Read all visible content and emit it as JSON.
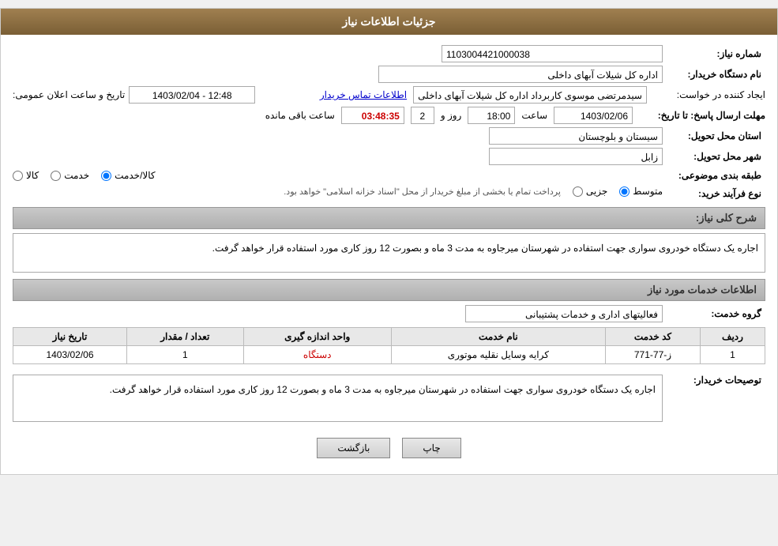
{
  "page": {
    "title": "جزئیات اطلاعات نیاز"
  },
  "header": {
    "shomara_niaz_label": "شماره نیاز:",
    "shomara_niaz_value": "1103004421000038",
    "nam_dastgah_label": "نام دستگاه خریدار:",
    "nam_dastgah_value": "اداره کل شیلات آبهای داخلی",
    "ijad_konande_label": "ایجاد کننده در خواست:",
    "ijad_konande_value": "سیدمرتضی موسوی کاربرداد اداره کل شیلات آبهای داخلی",
    "etelaat_link": "اطلاعات تماس خریدار",
    "tarikh_label": "تاریخ و ساعت اعلان عمومی:",
    "tarikh_value": "1403/02/04 - 12:48",
    "mohlat_label": "مهلت ارسال پاسخ: تا تاریخ:",
    "mohlat_date": "1403/02/06",
    "mohlat_saat_label": "ساعت",
    "mohlat_saat_value": "18:00",
    "mohlat_rooz_label": "روز و",
    "mohlat_rooz_value": "2",
    "mohlat_baqi_label": "ساعت باقی مانده",
    "mohlat_countdown": "03:48:35",
    "ostan_label": "استان محل تحویل:",
    "ostan_value": "سیستان و بلوچستان",
    "shahr_label": "شهر محل تحویل:",
    "shahr_value": "زابل",
    "tabaqe_label": "طبقه بندی موضوعی:",
    "tabaqe_options": [
      "کالا",
      "خدمت",
      "کالا/خدمت"
    ],
    "tabaqe_selected": "کالا/خدمت",
    "nooe_label": "نوع فرآیند خرید:",
    "nooe_options": [
      "جزیی",
      "متوسط"
    ],
    "nooe_selected": "متوسط",
    "nooe_note": "پرداخت تمام یا بخشی از مبلغ خریدار از محل \"اسناد خزانه اسلامی\" خواهد بود."
  },
  "sharh_section": {
    "title": "شرح کلی نیاز:",
    "text": "اجاره یک دستگاه خودروی سواری جهت استفاده در شهرستان میرجاوه به مدت 3 ماه و بصورت 12 روز کاری مورد استفاده قرار خواهد گرفت."
  },
  "khadamat_section": {
    "title": "اطلاعات خدمات مورد نیاز",
    "group_label": "گروه خدمت:",
    "group_value": "فعالیتهای اداری و خدمات پشتیبانی",
    "table": {
      "headers": [
        "ردیف",
        "کد خدمت",
        "نام خدمت",
        "واحد اندازه گیری",
        "تعداد / مقدار",
        "تاریخ نیاز"
      ],
      "rows": [
        {
          "radif": "1",
          "code": "ز-77-771",
          "name": "کرایه وسایل نقلیه موتوری",
          "unit": "دستگاه",
          "count": "1",
          "date": "1403/02/06"
        }
      ]
    }
  },
  "toseif_section": {
    "label": "توصیحات خریدار:",
    "text": "اجاره یک دستگاه خودروی سواری جهت استفاده در شهرستان میرجاوه به مدت 3 ماه و بصورت 12 روز کاری مورد استفاده قرار خواهد گرفت."
  },
  "buttons": {
    "print_label": "چاپ",
    "back_label": "بازگشت"
  }
}
